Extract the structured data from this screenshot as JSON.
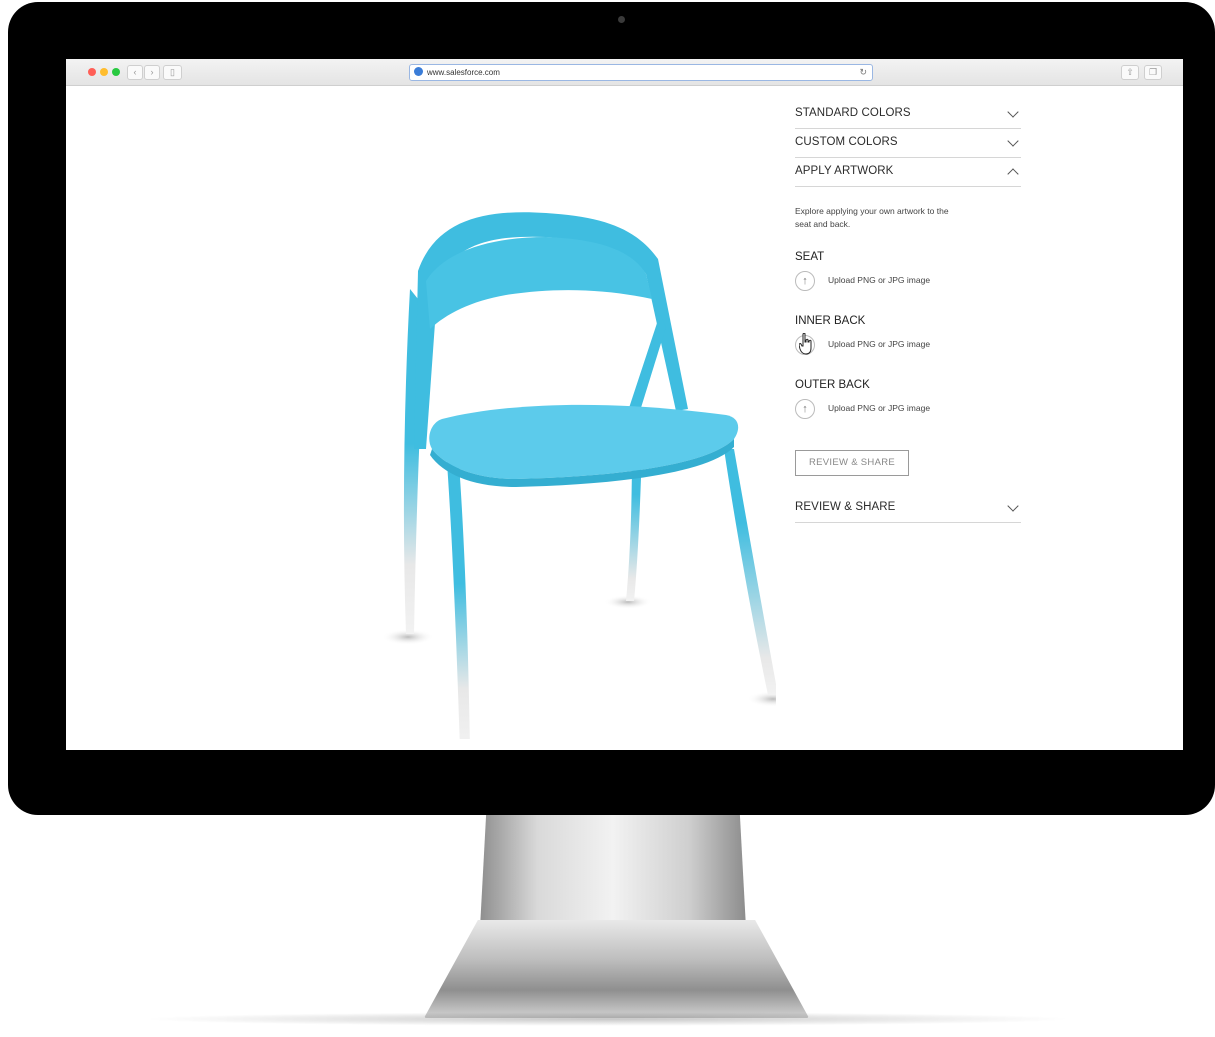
{
  "browser": {
    "url": "www.salesforce.com",
    "icons": [
      "globe-icon",
      "reload-icon",
      "share-icon",
      "tabs-icon"
    ]
  },
  "panel": {
    "accordion": [
      {
        "label": "STANDARD COLORS",
        "state": "collapsed"
      },
      {
        "label": "CUSTOM COLORS",
        "state": "collapsed"
      },
      {
        "label": "APPLY ARTWORK",
        "state": "expanded"
      }
    ],
    "artwork": {
      "description": "Explore applying your own artwork to the seat and back.",
      "sections": [
        {
          "title": "SEAT",
          "upload_label": "Upload PNG or JPG image"
        },
        {
          "title": "INNER BACK",
          "upload_label": "Upload PNG or JPG image"
        },
        {
          "title": "OUTER BACK",
          "upload_label": "Upload PNG or JPG image"
        }
      ],
      "review_button": "REVIEW & SHARE"
    },
    "review_section": {
      "label": "REVIEW & SHARE",
      "state": "collapsed"
    }
  },
  "colors": {
    "chair": "#3fbde0",
    "chair_light": "#5ccbeb",
    "legs_fade": "#e6e6e6"
  }
}
